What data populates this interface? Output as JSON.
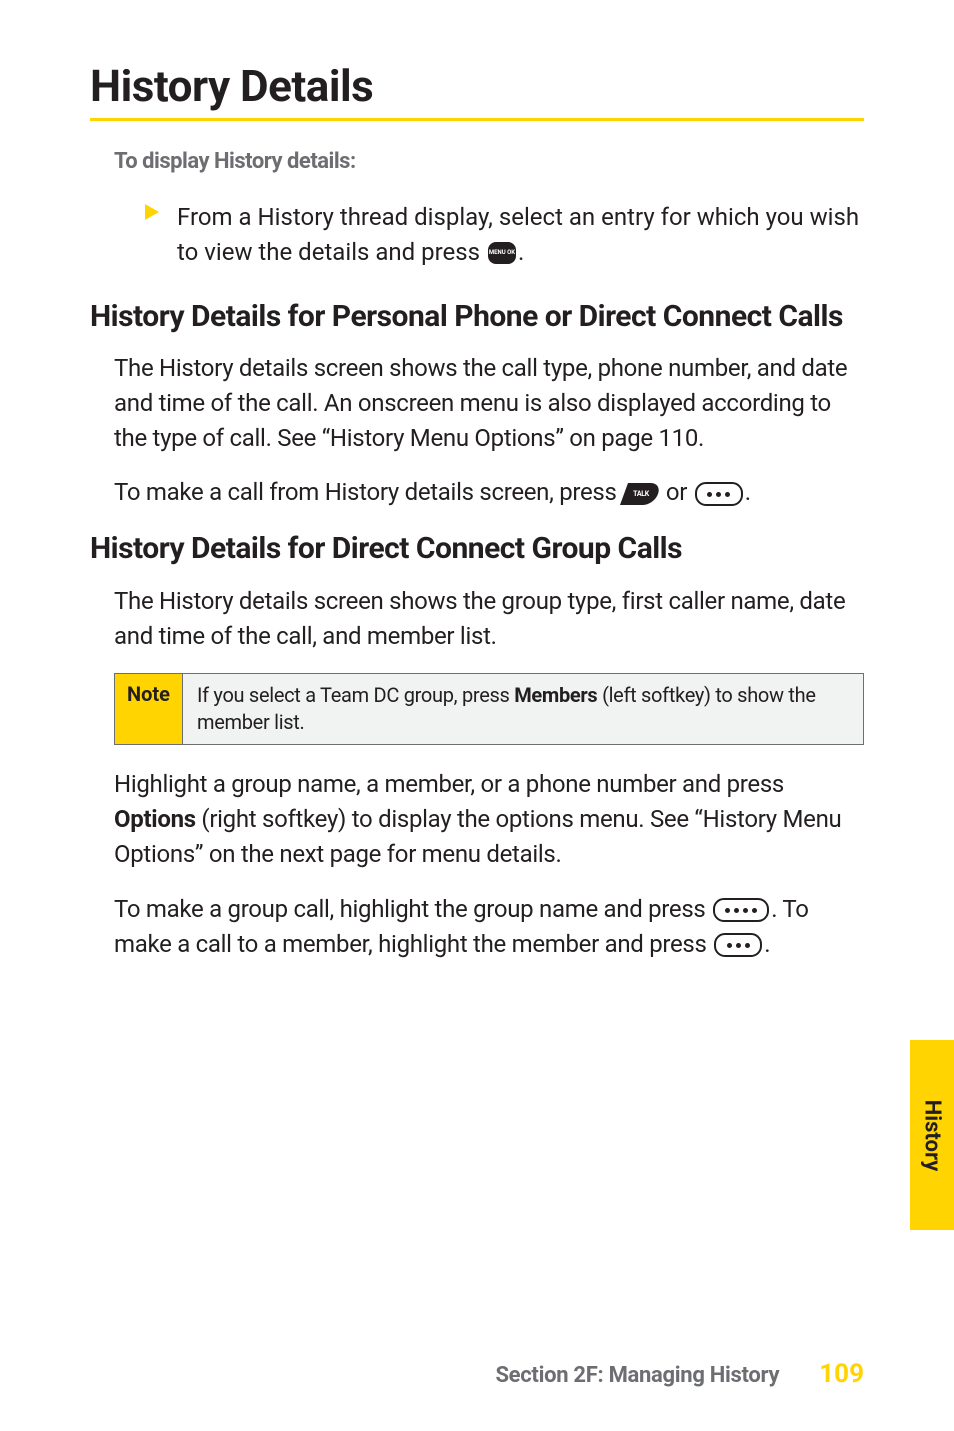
{
  "title": "History Details",
  "intro": "To display History details:",
  "bullet1_pre": "From a History thread display, select an entry for which you wish to view the details and press ",
  "bullet1_post": ".",
  "icon_menu_label": "MENU\nOK",
  "icon_talk_label": "TALK",
  "sub1_title": "History Details for Personal Phone or Direct Connect Calls",
  "sub1_p1": "The History details screen shows the call type, phone number, and date and time of the call. An onscreen menu is also displayed according to the type of call. See “History Menu Options” on page 110.",
  "sub1_p2_pre": "To make a call from History details screen, press ",
  "or_text": " or ",
  "sub1_p2_post": ".",
  "sub2_title": "History Details for Direct Connect Group Calls",
  "sub2_p1": "The History details screen shows the group type, first caller name, date and time of the call, and member list.",
  "note_label": "Note",
  "note_body_pre": "If you select a Team DC group, press ",
  "note_body_bold": "Members",
  "note_body_post": " (left softkey) to show the member list.",
  "sub2_p2_pre": "Highlight a group name, a member, or a phone number and press ",
  "sub2_p2_bold": "Options",
  "sub2_p2_mid": " (right softkey) to display the options menu. See “History Menu Options” on the next page for menu details.",
  "sub2_p3_pre": "To make a group call, highlight the group name and press ",
  "sub2_p3_mid": ". To make a call to a member, highlight the member and press ",
  "sub2_p3_post": ".",
  "side_tab": "History",
  "footer_section": "Section 2F: Managing History",
  "footer_page": "109"
}
